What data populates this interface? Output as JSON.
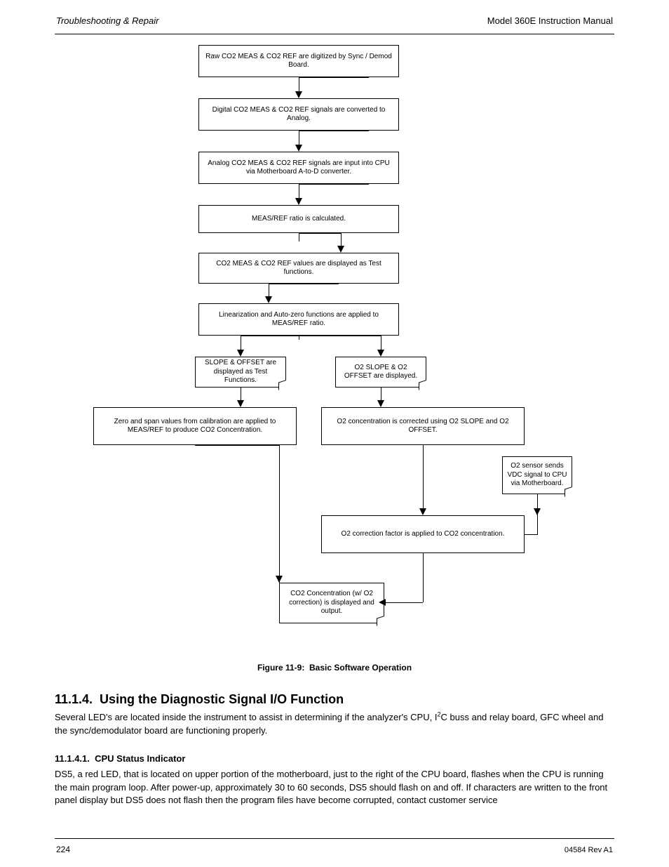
{
  "header": {
    "left_italic": "Troubleshooting & Repair",
    "right": "Model 360E Instruction Manual"
  },
  "flow": {
    "b1": "Raw CO2 MEAS & CO2 REF are digitized by Sync / Demod Board.",
    "b2": "Digital CO2 MEAS & CO2 REF signals are converted to Analog.",
    "b3": "Analog CO2 MEAS & CO2 REF signals are input into CPU via Motherboard A-to-D converter.",
    "b4": "MEAS/REF ratio is calculated.",
    "b5": "CO2 MEAS & CO2 REF values are displayed as Test functions.",
    "b6": "Linearization and Auto-zero functions are applied to MEAS/REF ratio.",
    "d1": "SLOPE & OFFSET are displayed as Test Functions.",
    "d2": "O2 SLOPE & O2 OFFSET are displayed.",
    "b7": "Zero and span values from calibration are applied to MEAS/REF to produce CO2 Concentration.",
    "b8": "O2 concentration is corrected using O2 SLOPE and O2 OFFSET.",
    "s1": "O2 sensor sends VDC signal to CPU via Motherboard.",
    "b9": "O2 correction factor is applied to CO2 concentration.",
    "d3": "CO2 Concentration (w/ O2 correction) is displayed and output."
  },
  "captions": {
    "fig": "Figure 11-9:  Basic Software Operation"
  },
  "sections": {
    "h2": "11.1.4.  Using the Diagnostic Signal I/O Function",
    "p1_a": "Several LED's are located inside the instrument to assist in determining if the analyzer's CPU, I",
    "p1_sup": "2",
    "p1_b": "C buss and relay board, GFC wheel and the sync/demodulator board are functioning properly.",
    "h3": "11.1.4.1.  CPU Status Indicator",
    "p2": "DS5, a red LED, that is located on upper portion of the motherboard, just to the right of the CPU board, flashes when the CPU is running the main program loop.  After power-up, approximately 30 to 60 seconds, DS5 should flash on and off. If characters are written to the front panel display but DS5 does not flash then the program files have become corrupted, contact customer service"
  },
  "footer": {
    "left": "224",
    "right": "04584 Rev A1"
  }
}
